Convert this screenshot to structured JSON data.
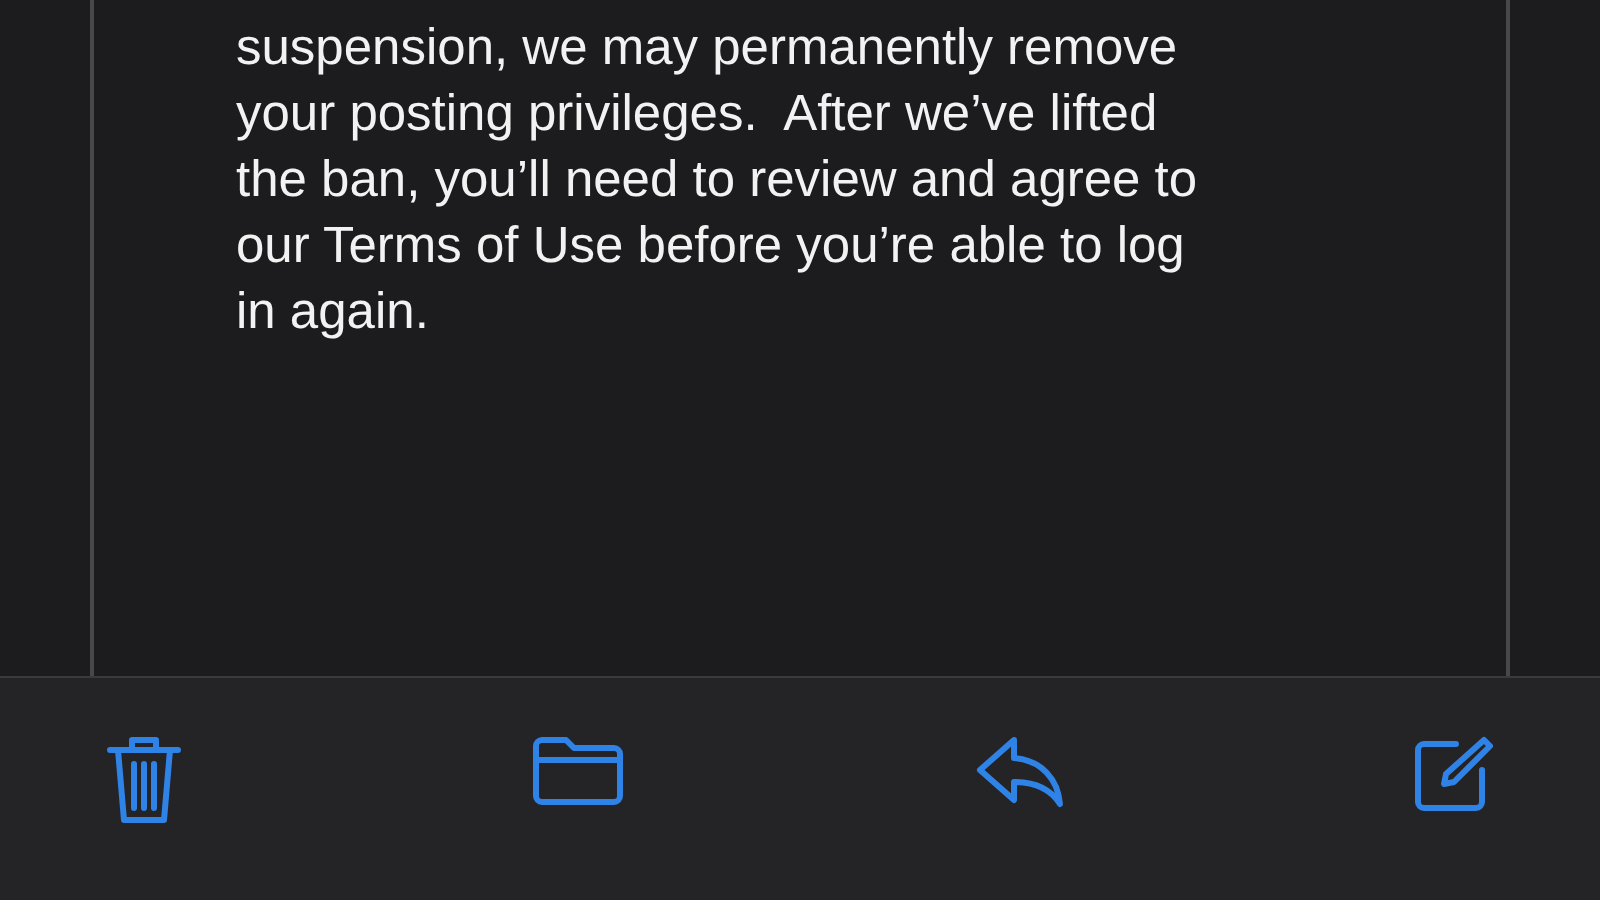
{
  "message": {
    "body": "suspension, we may permanently remove\nyour posting privileges.  After we’ve lifted\nthe ban, you’ll need to review and agree to\nour Terms of Use before you’re able to log\nin again."
  },
  "toolbar": [
    {
      "kind": "trash"
    },
    {
      "kind": "folder"
    },
    {
      "kind": "reply"
    },
    {
      "kind": "compose"
    }
  ]
}
